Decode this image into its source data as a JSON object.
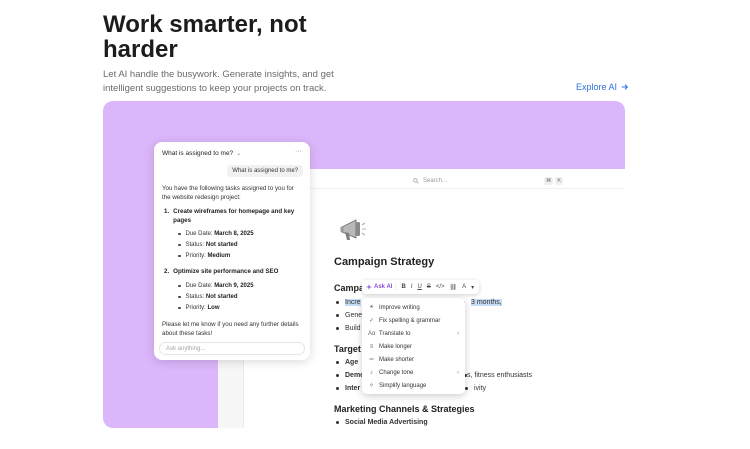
{
  "headline": "Work smarter, not harder",
  "subtext": "Let AI handle the busywork. Generate insights, and get intelligent suggestions to keep your projects on track.",
  "explore_link": "Explore AI",
  "doc": {
    "search_placeholder": "Search...",
    "shortcut": [
      "⌘",
      "K"
    ],
    "title": "Campaign Strategy",
    "h_campaign": "Campa",
    "campaign_bullets": [
      {
        "start": "Incre",
        "end": "3 months,"
      },
      {
        "start": "Gene",
        "end": "."
      },
      {
        "start": "Build",
        "end": ""
      }
    ],
    "h_target": "Target",
    "target_bullets": [
      {
        "bold": "Age",
        "rest": ""
      },
      {
        "bold": "Demo",
        "rest": "s, fitness enthusiasts"
      },
      {
        "bold": "Inter",
        "rest": "ivity"
      }
    ],
    "h_marketing": "Marketing Channels & Strategies",
    "marketing_bullets": [
      {
        "bold": "Social Media Advertising"
      }
    ]
  },
  "toolbar": {
    "ask_ai": "Ask AI",
    "bold": "B",
    "italic": "I",
    "underline": "U",
    "strike": "S",
    "code": "</>",
    "link": "⛓",
    "text_color": "A"
  },
  "ai_menu": [
    {
      "icon": "wand",
      "label": "Improve writing"
    },
    {
      "icon": "check",
      "label": "Fix spelling & grammar"
    },
    {
      "icon": "translate",
      "label": "Translate to",
      "submenu": true
    },
    {
      "icon": "longer",
      "label": "Make longer"
    },
    {
      "icon": "shorter",
      "label": "Make shorter"
    },
    {
      "icon": "mic",
      "label": "Change tone",
      "submenu": true
    },
    {
      "icon": "sparkle",
      "label": "Simplify language"
    }
  ],
  "chat": {
    "header": "What is assigned to me?",
    "more": "···",
    "user_message": "What is assigned to me?",
    "intro": "You have the following tasks assigned to you for the website redesign project:",
    "tasks": [
      {
        "num": "1.",
        "title": "Create wireframes for homepage and key pages",
        "due_label": "Due Date:",
        "due": "March 8, 2025",
        "status_label": "Status:",
        "status": "Not started",
        "priority_label": "Priority:",
        "priority": "Medium"
      },
      {
        "num": "2.",
        "title": "Optimize site performance and SEO",
        "due_label": "Due Date:",
        "due": "March 9, 2025",
        "status_label": "Status:",
        "status": "Not started",
        "priority_label": "Priority:",
        "priority": "Low"
      }
    ],
    "outro": "Please let me know if you need any further details about these tasks!",
    "input_placeholder": "Ask anything..."
  },
  "colors": {
    "hero_bg": "#dbb6fb",
    "accent_link": "#2f6fde",
    "ask_ai": "#8b4fd8",
    "highlight": "#c6dcf7"
  }
}
